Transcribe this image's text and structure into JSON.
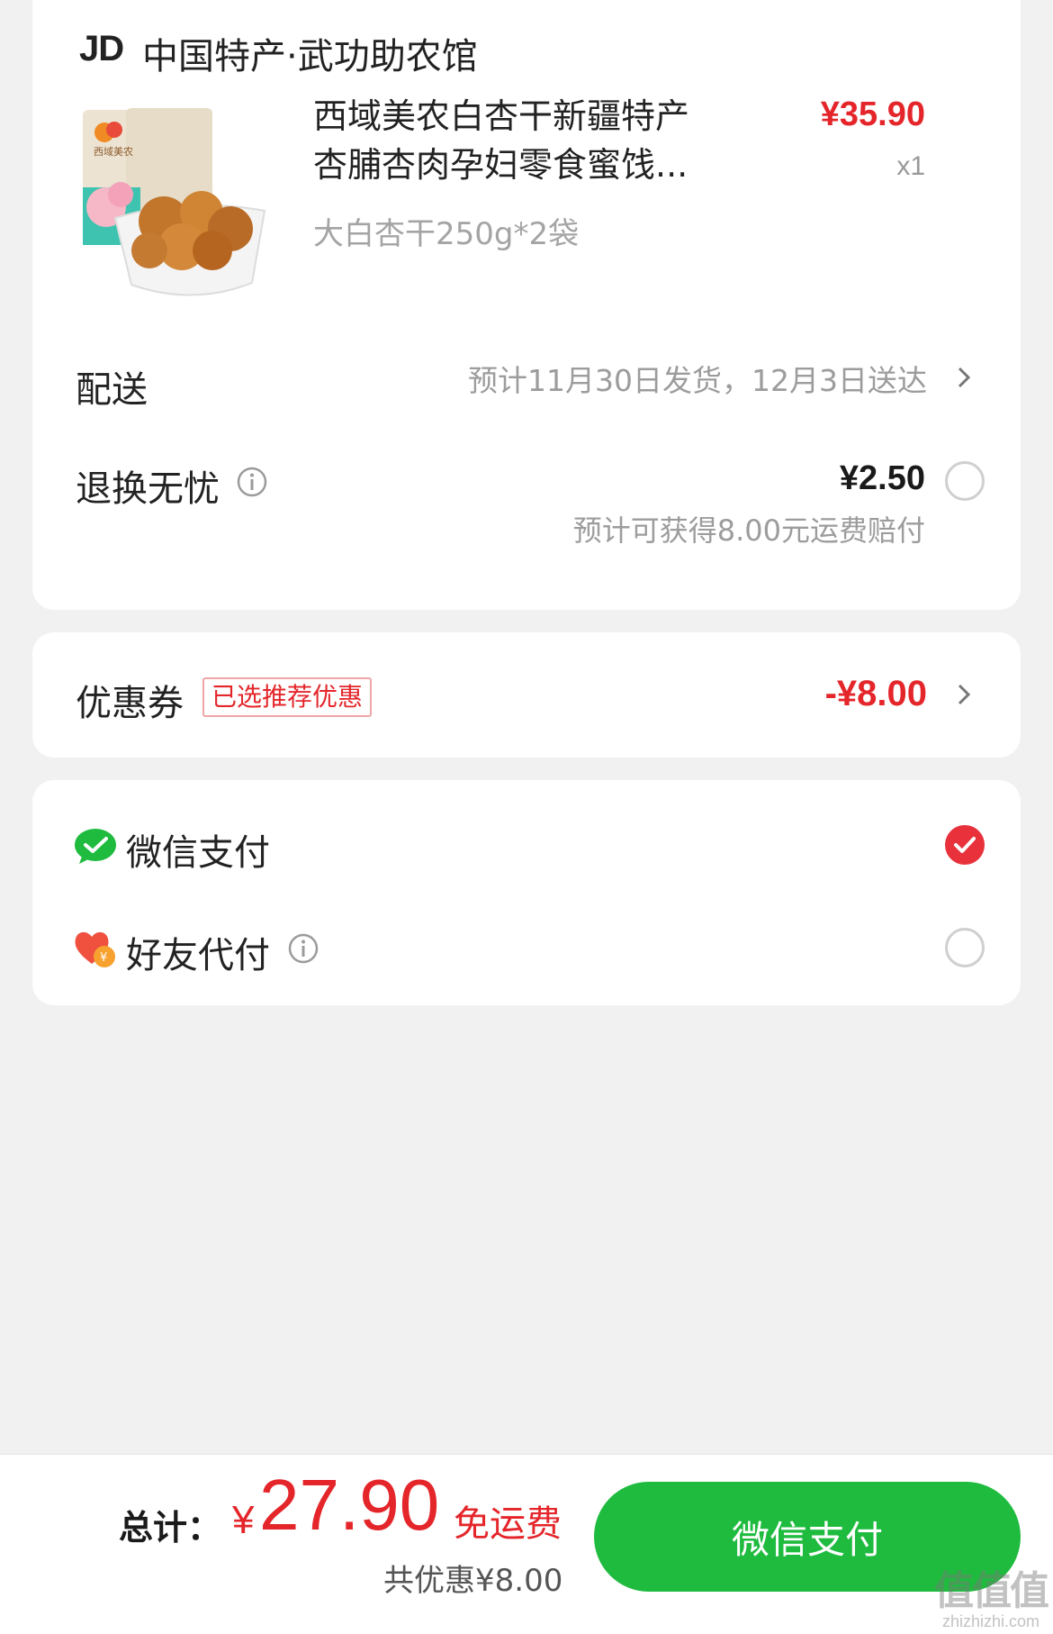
{
  "store": {
    "logo": "JD",
    "name": "中国特产·武功助农馆"
  },
  "product": {
    "title": "西域美农白杏干新疆特产杏脯杏肉孕妇零食蜜饯...",
    "price": "¥35.90",
    "quantity": "x1",
    "spec": "大白杏干250g*2袋",
    "package_brand": "西域美农"
  },
  "delivery": {
    "label": "配送",
    "value": "预计11月30日发货，12月3日送达"
  },
  "return_service": {
    "label": "退换无忧",
    "price": "¥2.50",
    "note": "预计可获得8.00元运费赔付",
    "selected": false
  },
  "coupon": {
    "label": "优惠券",
    "tag": "已选推荐优惠",
    "value": "-¥8.00"
  },
  "payment": {
    "options": [
      {
        "label": "微信支付",
        "icon": "wechat-pay-icon",
        "selected": true
      },
      {
        "label": "好友代付",
        "icon": "friend-pay-heart-icon",
        "selected": false
      }
    ]
  },
  "footer": {
    "total_label": "总计：",
    "currency": "¥",
    "total": "27.90",
    "shipping": "免运费",
    "discount": "共优惠¥8.00",
    "pay_button": "微信支付"
  },
  "watermark": {
    "mark": "值值值",
    "site": "zhizhizhi.com"
  },
  "colors": {
    "accent_red": "#e4262b",
    "wechat_green": "#1fbb3f",
    "background": "#f1f1f1"
  }
}
